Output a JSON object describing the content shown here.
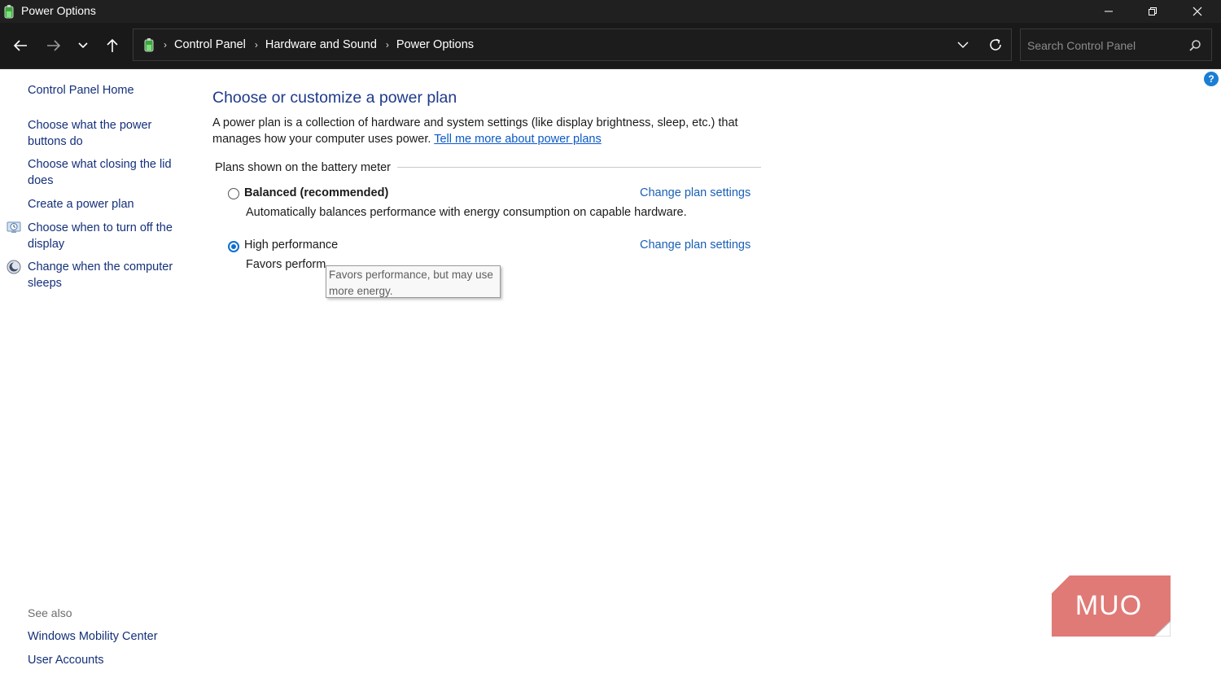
{
  "window": {
    "title": "Power Options"
  },
  "navbar": {
    "breadcrumb": [
      "Control Panel",
      "Hardware and Sound",
      "Power Options"
    ],
    "search_placeholder": "Search Control Panel"
  },
  "sidebar": {
    "home": "Control Panel Home",
    "links": [
      "Choose what the power buttons do",
      "Choose what closing the lid does",
      "Create a power plan",
      "Choose when to turn off the display",
      "Change when the computer sleeps"
    ],
    "see_also_heading": "See also",
    "see_also": [
      "Windows Mobility Center",
      "User Accounts"
    ]
  },
  "main": {
    "title": "Choose or customize a power plan",
    "intro": "A power plan is a collection of hardware and system settings (like display brightness, sleep, etc.) that manages how your computer uses power.",
    "intro_link": "Tell me more about power plans",
    "group_label": "Plans shown on the battery meter",
    "plans": [
      {
        "name": "Balanced (recommended)",
        "description": "Automatically balances performance with energy consumption on capable hardware.",
        "selected": false,
        "change_link": "Change plan settings"
      },
      {
        "name": "High performance",
        "description": "Favors perform",
        "selected": true,
        "change_link": "Change plan settings"
      }
    ],
    "tooltip": "Favors performance, but may use more energy."
  },
  "help_label": "?",
  "watermark": "MUO",
  "colors": {
    "titlebar": "#202020",
    "navbar": "#191919",
    "link": "#1a5fb4",
    "title": "#1e3a8a",
    "watermark": "#e07a76"
  }
}
